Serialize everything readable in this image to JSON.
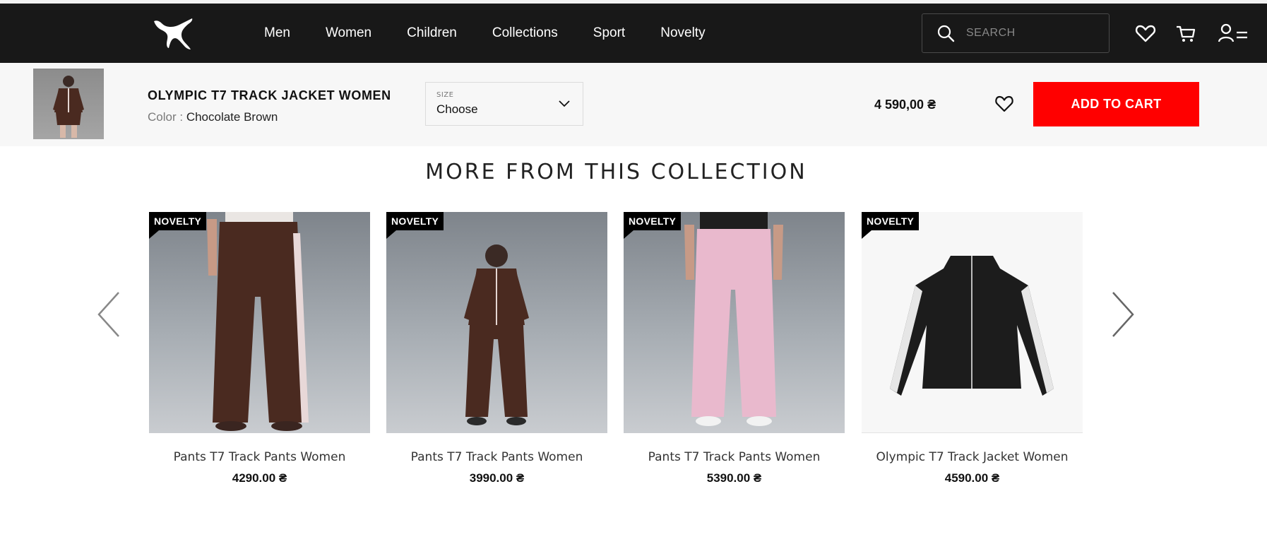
{
  "header": {
    "nav": [
      "Men",
      "Women",
      "Children",
      "Collections",
      "Sport",
      "Novelty"
    ],
    "search_placeholder": "SEARCH"
  },
  "product_bar": {
    "title": "OLYMPIC T7 TRACK JACKET WOMEN",
    "color_label": "Color :",
    "color_value": "Chocolate Brown",
    "size_label": "SIZE",
    "size_value": "Choose",
    "price": "4 590,00 ₴",
    "add_to_cart": "ADD TO CART"
  },
  "collection": {
    "title": "MORE FROM THIS COLLECTION",
    "items": [
      {
        "badge": "NOVELTY",
        "name": "Pants T7 Track Pants Women",
        "price": "4290.00 ₴"
      },
      {
        "badge": "NOVELTY",
        "name": "Pants T7 Track Pants Women",
        "price": "3990.00 ₴"
      },
      {
        "badge": "NOVELTY",
        "name": "Pants T7 Track Pants Women",
        "price": "5390.00 ₴"
      },
      {
        "badge": "NOVELTY",
        "name": "Olympic T7 Track Jacket Women",
        "price": "4590.00 ₴"
      }
    ]
  },
  "colors": {
    "header_bg": "#181818",
    "accent_red": "#ff0000",
    "bar_bg": "#f7f7f7",
    "chocolate": "#4a2a20",
    "pink": "#e9b9cd"
  }
}
